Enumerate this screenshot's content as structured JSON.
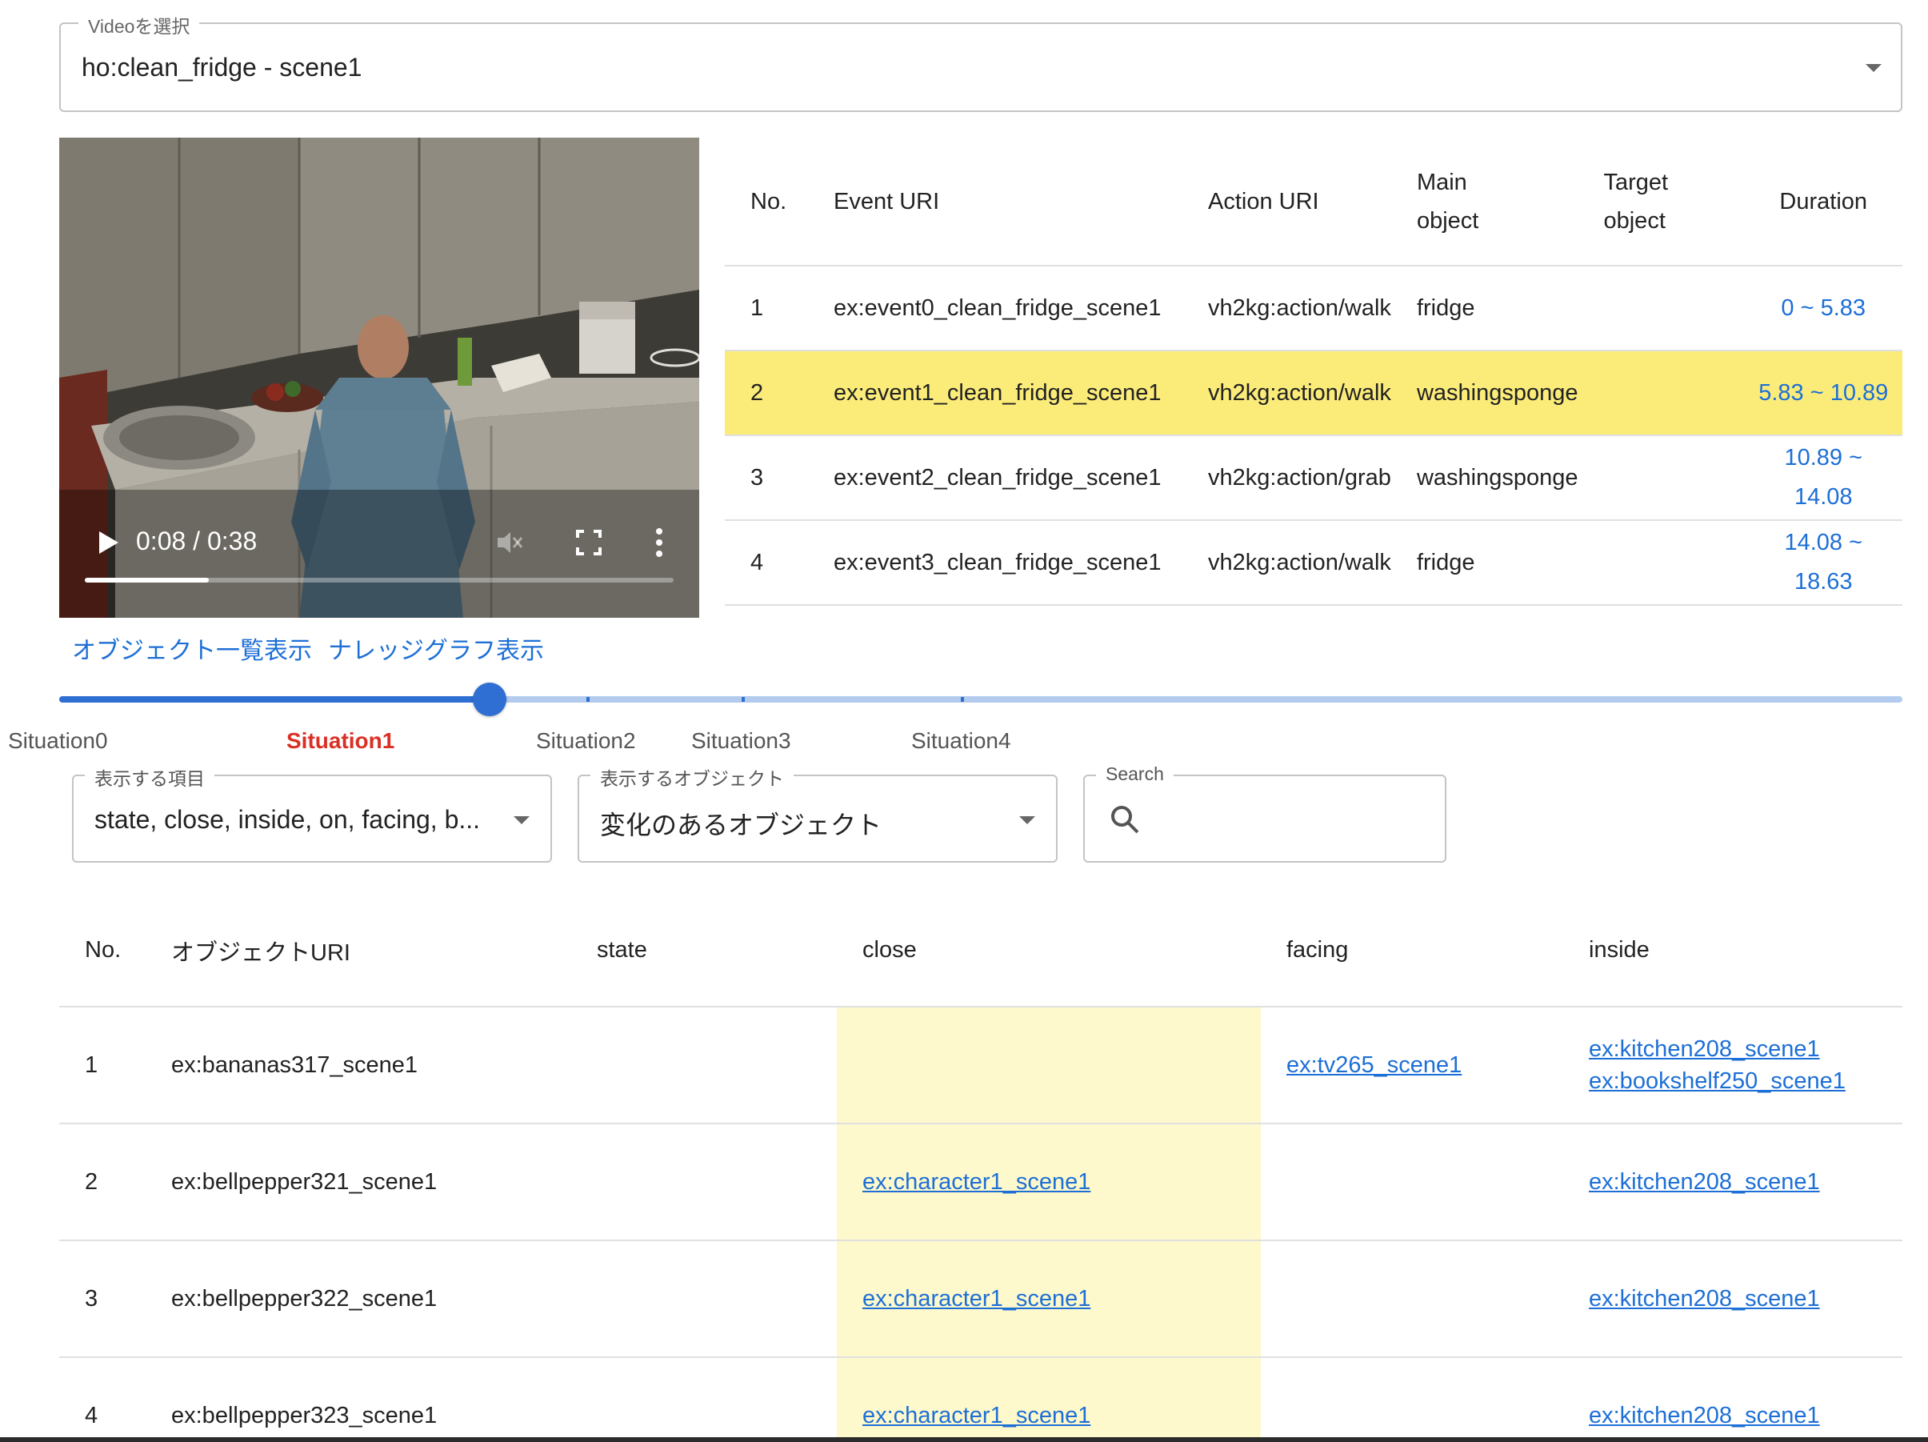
{
  "video_select": {
    "label": "Videoを選択",
    "value": "ho:clean_fridge - scene1"
  },
  "player": {
    "time": "0:08 / 0:38",
    "progress": 0.21
  },
  "events": {
    "headers": {
      "no": "No.",
      "event": "Event URI",
      "action": "Action URI",
      "main1": "Main",
      "main2": "object",
      "target1": "Target",
      "target2": "object",
      "duration": "Duration"
    },
    "rows": [
      {
        "no": "1",
        "event": "ex:event0_clean_fridge_scene1",
        "action": "vh2kg:action/walk",
        "main": "fridge",
        "target": "",
        "dur1": "0 ~ 5.83",
        "dur2": ""
      },
      {
        "no": "2",
        "event": "ex:event1_clean_fridge_scene1",
        "action": "vh2kg:action/walk",
        "main": "washingsponge",
        "target": "",
        "dur1": "5.83 ~ 10.89",
        "dur2": ""
      },
      {
        "no": "3",
        "event": "ex:event2_clean_fridge_scene1",
        "action": "vh2kg:action/grab",
        "main": "washingsponge",
        "target": "",
        "dur1": "10.89 ~",
        "dur2": "14.08"
      },
      {
        "no": "4",
        "event": "ex:event3_clean_fridge_scene1",
        "action": "vh2kg:action/walk",
        "main": "fridge",
        "target": "",
        "dur1": "14.08 ~",
        "dur2": "18.63"
      }
    ],
    "highlight_color": "#fbec7a"
  },
  "links": {
    "object_list": "オブジェクト一覧表示",
    "knowledge_graph": "ナレッジグラフ表示"
  },
  "slider": {
    "situations": [
      "Situation0",
      "Situation1",
      "Situation2",
      "Situation3",
      "Situation4"
    ],
    "active": "Situation1",
    "active_color": "#d93025"
  },
  "filters": {
    "items": {
      "label": "表示する項目",
      "value": "state, close, inside, on, facing, b..."
    },
    "objects": {
      "label": "表示するオブジェクト",
      "value": "変化のあるオブジェクト"
    },
    "search": {
      "label": "Search",
      "value": ""
    }
  },
  "objects": {
    "headers": {
      "no": "No.",
      "uri": "オブジェクトURI",
      "state": "state",
      "close": "close",
      "facing": "facing",
      "inside": "inside"
    },
    "rows": [
      {
        "no": "1",
        "uri": "ex:bananas317_scene1",
        "state": "",
        "close": "",
        "facing": "ex:tv265_scene1",
        "inside1": "ex:kitchen208_scene1",
        "inside2": "ex:bookshelf250_scene1"
      },
      {
        "no": "2",
        "uri": "ex:bellpepper321_scene1",
        "state": "",
        "close": "ex:character1_scene1",
        "facing": "",
        "inside1": "ex:kitchen208_scene1",
        "inside2": ""
      },
      {
        "no": "3",
        "uri": "ex:bellpepper322_scene1",
        "state": "",
        "close": "ex:character1_scene1",
        "facing": "",
        "inside1": "ex:kitchen208_scene1",
        "inside2": ""
      },
      {
        "no": "4",
        "uri": "ex:bellpepper323_scene1",
        "state": "",
        "close": "ex:character1_scene1",
        "facing": "",
        "inside1": "ex:kitchen208_scene1",
        "inside2": ""
      }
    ],
    "highlight_column": "close",
    "highlight_color": "#fef9cc"
  },
  "colors": {
    "accent": "#2f6fd3",
    "link": "#1d6fd6"
  }
}
